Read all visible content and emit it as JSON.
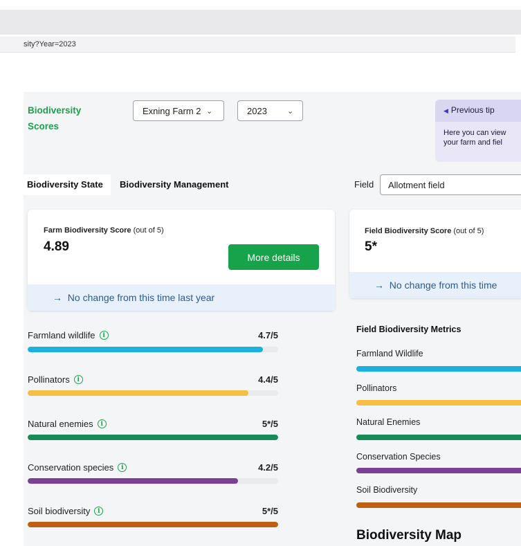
{
  "browser": {
    "url_fragment": "sity?Year=2023"
  },
  "header": {
    "title": "Biodiversity Scores",
    "farm_select": "Exning Farm 2",
    "year_select": "2023"
  },
  "tip": {
    "prev_label": "Previous tip",
    "text_line1": "Here you can view",
    "text_line2": "your farm and fiel"
  },
  "tabs": [
    {
      "label": "Biodiversity State",
      "active": true
    },
    {
      "label": "Biodiversity Management",
      "active": false
    }
  ],
  "field_picker": {
    "label": "Field",
    "value": "Allotment field"
  },
  "farm_card": {
    "label_bold": "Farm Biodiversity Score",
    "label_suffix": "(out of 5)",
    "score": "4.89",
    "button": "More details",
    "change": "No change from this time last year"
  },
  "field_card": {
    "label_bold": "Field Biodiversity Score",
    "label_suffix": "(out of 5)",
    "score": "5*",
    "change": "No change from this time"
  },
  "farm_metrics": [
    {
      "name": "Farmland wildlife",
      "value": "4.7/5",
      "fraction": 0.94,
      "color": "#1bb0df"
    },
    {
      "name": "Pollinators",
      "value": "4.4/5",
      "fraction": 0.88,
      "color": "#f6bf43"
    },
    {
      "name": "Natural enemies",
      "value": "5*/5",
      "fraction": 1.0,
      "color": "#178a57"
    },
    {
      "name": "Conservation species",
      "value": "4.2/5",
      "fraction": 0.84,
      "color": "#7b3f96"
    },
    {
      "name": "Soil biodiversity",
      "value": "5*/5",
      "fraction": 1.0,
      "color": "#bf5f0f"
    }
  ],
  "field_metrics": {
    "title": "Field Biodiversity Metrics",
    "items": [
      {
        "name": "Farmland Wildlife",
        "color": "#1bb0df"
      },
      {
        "name": "Pollinators",
        "color": "#f6bf43"
      },
      {
        "name": "Natural Enemies",
        "color": "#178a57"
      },
      {
        "name": "Conservation Species",
        "color": "#7b3f96"
      },
      {
        "name": "Soil Biodiversity",
        "color": "#bf5f0f"
      }
    ]
  },
  "map": {
    "title": "Biodiversity Map"
  },
  "icons": {
    "info": "info-circle-icon",
    "arrow": "arrow-right-icon",
    "chevron": "chevron-down-icon",
    "prev": "caret-left-icon"
  }
}
